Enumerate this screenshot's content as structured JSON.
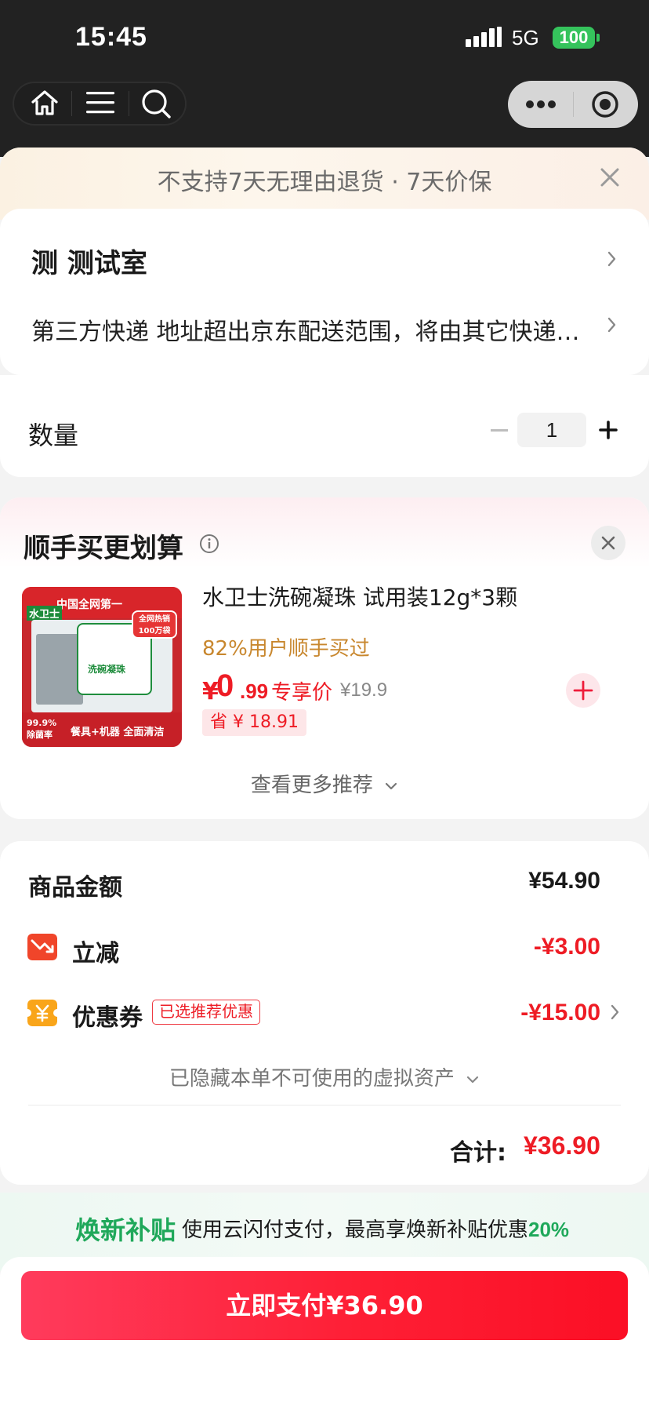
{
  "status_bar": {
    "time": "15:45",
    "network": "5G",
    "battery": "100"
  },
  "banner": {
    "text": "不支持7天无理由退货 · 7天价保"
  },
  "address": {
    "store": "测 测试室",
    "shipping": "第三方快递  地址超出京东配送范围，将由其它快递配送"
  },
  "quantity": {
    "label": "数量",
    "value": "1"
  },
  "deal": {
    "title": "顺手买更划算",
    "product": {
      "name": "水卫士洗碗凝珠 试用装12g*3颗",
      "buyers": "82%用户顺手买过",
      "price_symbol": "¥",
      "price_int": "0",
      "price_dec": ".99",
      "price_tag": "专享价",
      "original_price": "¥19.9",
      "save": "省 ¥ 18.91",
      "image_text": {
        "top": "中国全网第一",
        "brand": "水卫士",
        "badge": "全网热销 100万袋",
        "pack": "洗碗凝珠",
        "left": "99.9% 除菌率",
        "bottom": "餐具+机器 全面清洁"
      }
    },
    "more": "查看更多推荐"
  },
  "summary": {
    "goods_label": "商品金额",
    "goods_amount": "¥54.90",
    "discount_label": "立减",
    "discount_amount": "-¥3.00",
    "coupon_label": "优惠券",
    "coupon_tag": "已选推荐优惠",
    "coupon_amount": "-¥15.00",
    "hidden_assets": "已隐藏本单不可使用的虚拟资产",
    "total_label": "合计:",
    "total_amount": "¥36.90"
  },
  "subsidy": {
    "title": "焕新补贴",
    "text": "使用云闪付支付，最高享焕新补贴优惠",
    "percent": "20%"
  },
  "pay_button": "立即支付¥36.90",
  "colors": {
    "accent": "#ee1c25",
    "green": "#1fa85a",
    "orange": "#c8872e"
  }
}
